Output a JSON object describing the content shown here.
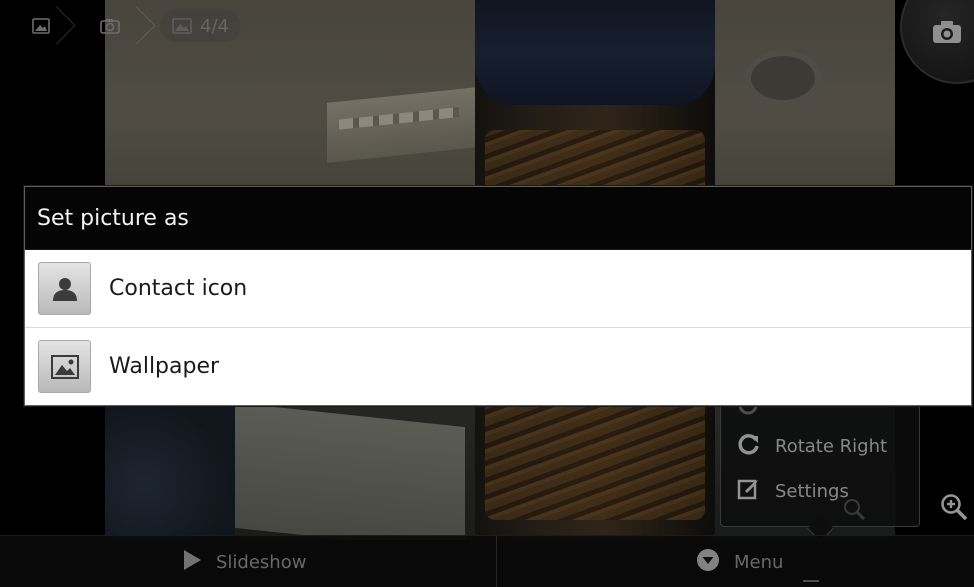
{
  "nav": {
    "album_icon": "gallery-icon",
    "camera_icon": "camera-icon",
    "image_icon": "image-icon",
    "counter": "4/4"
  },
  "dialog": {
    "title": "Set picture as",
    "items": [
      {
        "label": "Contact icon",
        "icon": "contact-person-icon"
      },
      {
        "label": "Wallpaper",
        "icon": "wallpaper-icon"
      }
    ]
  },
  "popup_menu": {
    "items": [
      {
        "label": "Rotate Right",
        "icon": "rotate-right-icon"
      },
      {
        "label": "Settings",
        "icon": "settings-icon"
      }
    ]
  },
  "bottom_bar": {
    "slideshow_label": "Slideshow",
    "menu_label": "Menu"
  },
  "colors": {
    "dialog_title_bg": "#050505",
    "dialog_body_bg": "#ffffff",
    "bottom_bar_bg": "#0f0f0f"
  }
}
